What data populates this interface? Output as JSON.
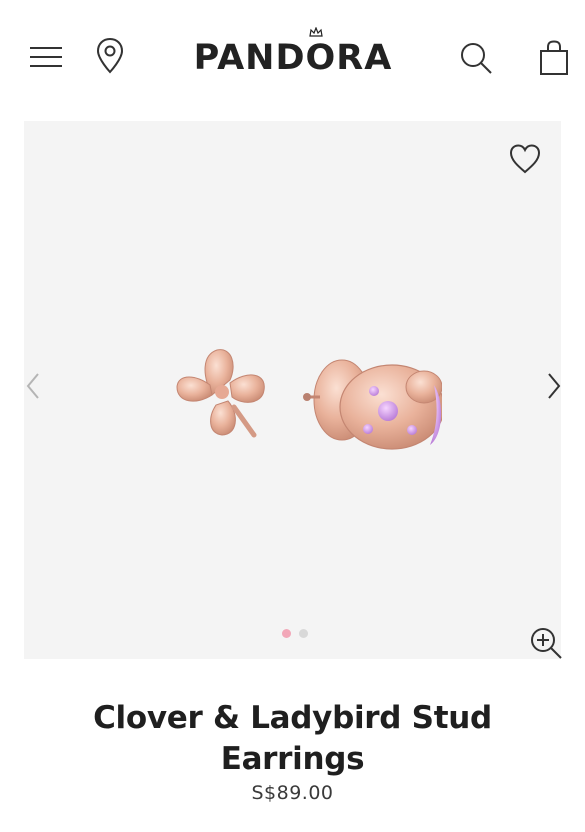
{
  "header": {
    "brand": "PANDORA",
    "icons": [
      "menu-icon",
      "location-pin-icon",
      "search-icon",
      "shopping-bag-icon"
    ]
  },
  "gallery": {
    "icons": [
      "heart-icon",
      "chevron-left-icon",
      "chevron-right-icon",
      "zoom-in-icon"
    ],
    "active_dot_color": "#f2a7b8",
    "inactive_dot_color": "#d8d8d8",
    "slides_count": 2,
    "active_slide": 1
  },
  "product": {
    "name": "Clover & Ladybird Stud Earrings",
    "price": "S$89.00"
  },
  "colors": {
    "text": "#1f1f1f",
    "gallery_bg": "#f4f4f4",
    "rose_gold": "#e8b3a0"
  }
}
